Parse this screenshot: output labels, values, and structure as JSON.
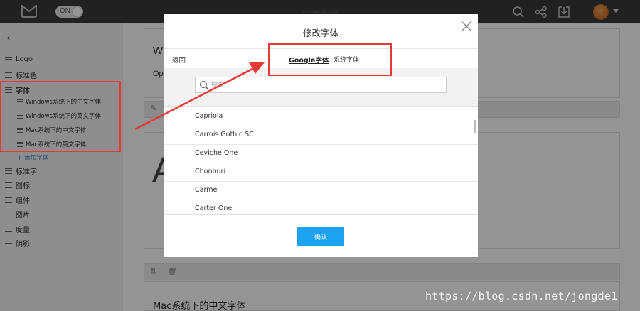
{
  "header": {
    "app_title": "设计系统",
    "toggle_label": "ON"
  },
  "sidebar": {
    "items": [
      {
        "label": "Logo"
      },
      {
        "label": "标准色"
      },
      {
        "label": "字体"
      },
      {
        "label": "标准字"
      },
      {
        "label": "图标"
      },
      {
        "label": "组件"
      },
      {
        "label": "图片"
      },
      {
        "label": "度量"
      },
      {
        "label": "阴影"
      }
    ],
    "font_subitems": [
      {
        "label": "Windows系统下的中文字体"
      },
      {
        "label": "Windows系统下的英文字体"
      },
      {
        "label": "Mac系统下的中文字体"
      },
      {
        "label": "Mac系统下的英文字体"
      }
    ],
    "add_font_label": "添加字体"
  },
  "main": {
    "heading_partial": "W",
    "subtext_partial": "Op",
    "big_letter": "A",
    "footer_title": "Mac系统下的中文字体"
  },
  "modal": {
    "title": "修改字体",
    "back_label": "返回",
    "tabs": [
      {
        "label": "Google字体",
        "active": true
      },
      {
        "label": "系统字体",
        "active": false
      }
    ],
    "search_placeholder": "搜索",
    "fonts": [
      {
        "name": "Capriola"
      },
      {
        "name": "Carrois Gothic SC"
      },
      {
        "name": "Ceviche One"
      },
      {
        "name": "Chonburi"
      },
      {
        "name": "Carme"
      },
      {
        "name": "Carter One"
      }
    ],
    "confirm_label": "确认"
  },
  "watermark": "https://blog.csdn.net/jongde1",
  "colors": {
    "accent": "#1ea3f3",
    "annotation": "#e53935",
    "topbar": "#3a3a3a"
  }
}
